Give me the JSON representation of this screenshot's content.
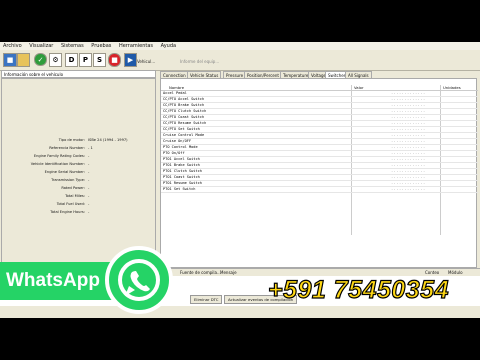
{
  "menubar": [
    "Archivo",
    "Visualizar",
    "Sistemas",
    "Pruebas",
    "Herramientas",
    "Ayuda"
  ],
  "toolbar": {
    "buttons": [
      "D",
      "P",
      "S"
    ],
    "vehicle_label": "Vehicul...",
    "report_label": "Informe del equip..."
  },
  "left_panel": {
    "title": "Información sobre el vehículo",
    "rows": [
      {
        "label": "Tipo de motor:",
        "value": "ISBe 24 (1994 - 1997)"
      },
      {
        "label": "Referencia Number:",
        "value": "- 1"
      },
      {
        "label": "Engine Family Rating Codes:",
        "value": "-"
      },
      {
        "label": "Vehicle Identification Number:",
        "value": "-"
      },
      {
        "label": "Engine Serial Number:",
        "value": "-"
      },
      {
        "label": "Transmission Type:",
        "value": "-"
      },
      {
        "label": "Rated Power:",
        "value": "-"
      },
      {
        "label": "Total Miles:",
        "value": "-"
      },
      {
        "label": "Total Fuel Used:",
        "value": "-"
      },
      {
        "label": "Total Engine Hours:",
        "value": "-"
      }
    ]
  },
  "tabs": [
    "Connection",
    "Vehicle Status",
    "Pressure",
    "Position/Percent",
    "Temperature",
    "Voltage",
    "Switches",
    "All Signals"
  ],
  "active_tab": "Switches",
  "grid": {
    "headers": {
      "name": "Nombre",
      "value": "Valor",
      "units": "Unidades"
    },
    "rows": [
      {
        "name": "Accel Pedal",
        "value": "............."
      },
      {
        "name": "CC/PTO Accel Switch",
        "value": "............."
      },
      {
        "name": "CC/PTO Brake Switch",
        "value": "............."
      },
      {
        "name": "CC/PTO Clutch Switch",
        "value": "............."
      },
      {
        "name": "CC/PTO Coast Switch",
        "value": "............."
      },
      {
        "name": "CC/PTO Resume Switch",
        "value": "............."
      },
      {
        "name": "CC/PTO Set Switch",
        "value": "............."
      },
      {
        "name": "Cruise Control Mode",
        "value": "............."
      },
      {
        "name": "Cruise On/OFF",
        "value": "............."
      },
      {
        "name": "PTO Control Mode",
        "value": "............."
      },
      {
        "name": "PTO On/Off",
        "value": "............."
      },
      {
        "name": "PTO1 Accel Switch",
        "value": "............."
      },
      {
        "name": "PTO1 Brake Switch",
        "value": "............."
      },
      {
        "name": "PTO1 Clutch Switch",
        "value": "............."
      },
      {
        "name": "PTO1 Coast Switch",
        "value": "............."
      },
      {
        "name": "PTO1 Resume Switch",
        "value": "............."
      },
      {
        "name": "PTO1 Set Switch",
        "value": "............."
      }
    ]
  },
  "bottom_bar": {
    "col1": "Fuente de compila...",
    "col2": "Mensaje",
    "col3": "Conteo",
    "col4": "Módulo"
  },
  "bottom_buttons": {
    "clear_dtc": "Eliminar DTC",
    "update_events": "Actualizar eventos de compilación"
  },
  "overlay": {
    "brand": "WhatsApp",
    "phone": "+591 75450354"
  },
  "colors": {
    "whatsapp": "#25d366",
    "phone_text": "#ffd814",
    "window_bg": "#ece9d8"
  }
}
